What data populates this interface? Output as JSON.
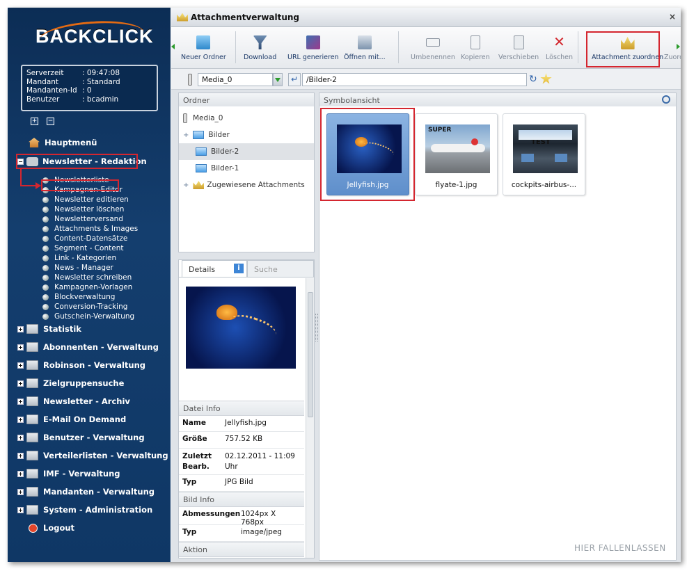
{
  "brand": {
    "logo": "BACKCLICK"
  },
  "session": [
    {
      "key": "Serverzeit",
      "value": ": 09:47:08"
    },
    {
      "key": "Mandant",
      "value": ": Standard"
    },
    {
      "key": "Mandanten-Id",
      "value": ": 0"
    },
    {
      "key": "Benutzer",
      "value": ": bcadmin"
    }
  ],
  "menu": {
    "hauptmenu": "Hauptmenü",
    "redaktion": "Newsletter - Redaktion",
    "redaktion_items": [
      "Newsletterliste",
      "Kampagnen-Editor",
      "Newsletter editieren",
      "Newsletter löschen",
      "Newsletterversand",
      "Attachments & Images",
      "Content-Datensätze",
      "Segment - Content",
      "Link - Kategorien",
      "News - Manager",
      "Newsletter schreiben",
      "Kampagnen-Vorlagen",
      "Blockverwaltung",
      "Conversion-Tracking",
      "Gutschein-Verwaltung"
    ],
    "sections": [
      "Statistik",
      "Abonnenten - Verwaltung",
      "Robinson - Verwaltung",
      "Zielgruppensuche",
      "Newsletter - Archiv",
      "E-Mail On Demand",
      "Benutzer - Verwaltung",
      "Verteilerlisten - Verwaltung",
      "IMF - Verwaltung",
      "Mandanten - Verwaltung",
      "System - Administration"
    ],
    "logout": "Logout"
  },
  "window": {
    "title": "Attachmentverwaltung",
    "close": "×"
  },
  "toolbar": {
    "neuer_ordner": "Neuer Ordner",
    "download": "Download",
    "url": "URL generieren",
    "oeffnen": "Öffnen mit...",
    "umbenennen": "Umbenennen",
    "kopieren": "Kopieren",
    "verschieben": "Verschieben",
    "loeschen": "Löschen",
    "zuordnen": "Attachment zuordnen",
    "zuord_cut": "Zuord"
  },
  "path": {
    "media": "Media_0",
    "folder": "/Bilder-2"
  },
  "ordner": {
    "header": "Ordner",
    "root": "Media_0",
    "items": [
      "Bilder",
      "Bilder-2",
      "Bilder-1"
    ],
    "assigned": "Zugewiesene Attachments"
  },
  "details": {
    "tab_details": "Details",
    "tab_suche": "Suche",
    "datei_info": "Datei Info",
    "name_k": "Name",
    "name_v": "Jellyfish.jpg",
    "groesse_k": "Größe",
    "groesse_v": "757.52 KB",
    "zuletzt_k1": "Zuletzt",
    "zuletzt_k2": "Bearb.",
    "zuletzt_v1": "02.12.2011 - 11:09",
    "zuletzt_v2": "Uhr",
    "typ_k": "Typ",
    "typ_v": "JPG Bild",
    "bild_info": "Bild Info",
    "abm_k": "Abmessungen",
    "abm_v": "1024px X 768px",
    "btyp_k": "Typ",
    "btyp_v": "image/jpeg",
    "aktion": "Aktion"
  },
  "symbol": {
    "header": "Symbolansicht",
    "files": [
      {
        "name": "Jellyfish.jpg"
      },
      {
        "name": "flyate-1.jpg",
        "overlay": "SUPER"
      },
      {
        "name": "cockpits-airbus-...",
        "overlay": "TEST"
      }
    ],
    "drop": "HIER FALLENLASSEN"
  }
}
